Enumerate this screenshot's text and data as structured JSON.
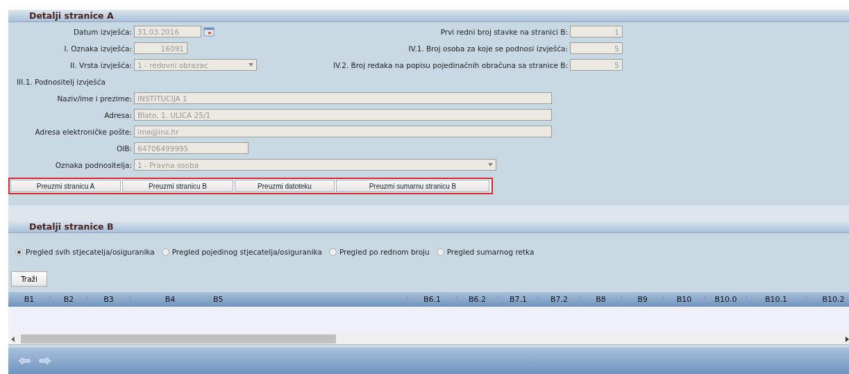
{
  "panel_a": {
    "title": "Detalji stranice A",
    "left_fields": [
      {
        "kind": "date",
        "label": "Datum izvješća:",
        "value": "31.03.2016"
      },
      {
        "kind": "number",
        "label": "I. Oznaka izvješća:",
        "value": "16091"
      },
      {
        "kind": "select",
        "label": "II. Vrsta izvješća:",
        "value": "1 - redovni obrazac"
      },
      {
        "kind": "section",
        "label": "III.1. Podnositelj izvješća"
      },
      {
        "kind": "wide",
        "label": "Naziv/ime i prezime:",
        "value": "INSTITUCIJA 1"
      },
      {
        "kind": "wide",
        "label": "Adresa:",
        "value": "Blato, 1. ULICA 25/1"
      },
      {
        "kind": "wide",
        "label": "Adresa elektroničke pošte:",
        "value": "ime@ins.hr"
      },
      {
        "kind": "text",
        "label": "OIB:",
        "value": "64706499995"
      },
      {
        "kind": "longselect",
        "label": "Oznaka podnositelja:",
        "value": "1 - Pravna osoba"
      }
    ],
    "right_fields": [
      {
        "label": "Prvi redni broj stavke na stranici B:",
        "value": "1"
      },
      {
        "label": "IV.1. Broj osoba za koje se podnosi izvješća:",
        "value": "5"
      },
      {
        "label": "IV.2. Broj redaka na popisu pojedinačnih obračuna sa stranice B:",
        "value": "5"
      }
    ],
    "buttons": [
      "Preuzmi stranicu A",
      "Preuzmi stranicu B",
      "Preuzmi datoteku",
      "Preuzmi sumarnu stranicu B"
    ]
  },
  "panel_b": {
    "title": "Detalji stranice B",
    "radios": [
      {
        "label": "Pregled svih stjecatelja/osiguranika",
        "selected": true
      },
      {
        "label": "Pregled pojedinog stjecatelja/osiguranika",
        "selected": false
      },
      {
        "label": "Pregled po rednom broju",
        "selected": false
      },
      {
        "label": "Pregled sumarnog retka",
        "selected": false
      }
    ],
    "search_button": "Traži",
    "columns": [
      "B1",
      "B2",
      "B3",
      "B4",
      "B5",
      "B6.1",
      "B6.2",
      "B7.1",
      "B7.2",
      "B8",
      "B9",
      "B10",
      "B10.0",
      "B10.1",
      "B10.2"
    ]
  }
}
